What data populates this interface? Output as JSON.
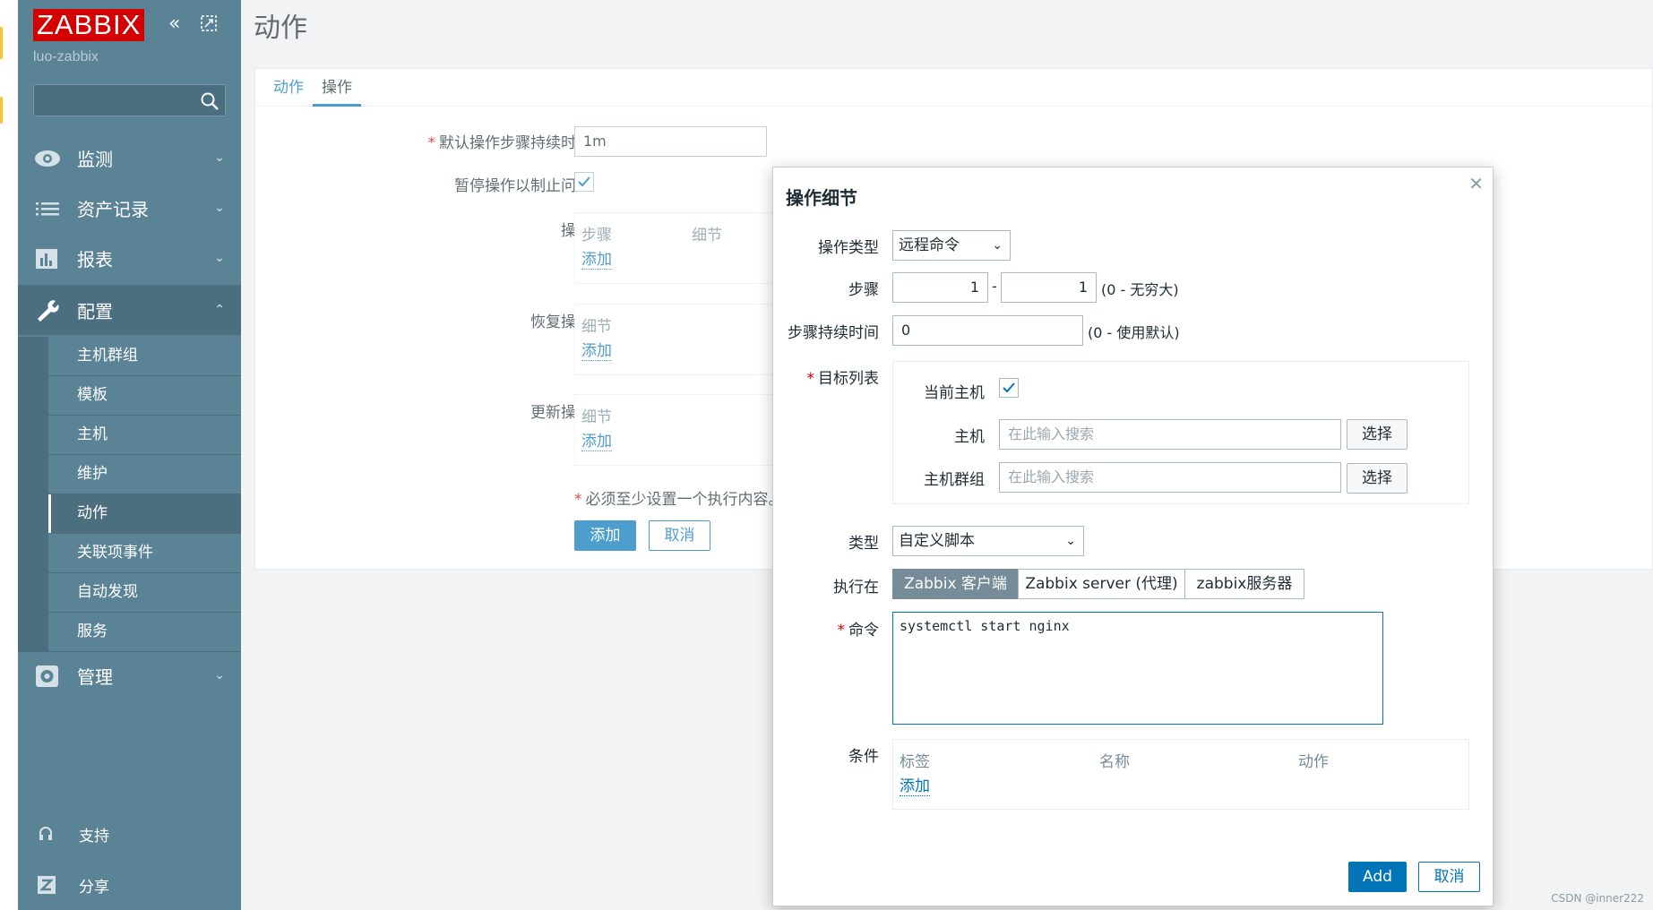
{
  "sidebar": {
    "logo": "ZABBIX",
    "server_name": "luo-zabbix",
    "collapse_icon": "double-chevron-left-icon",
    "kiosk_icon": "kiosk-mode-icon",
    "menu": [
      {
        "label": "监测",
        "icon": "eye-icon"
      },
      {
        "label": "资产记录",
        "icon": "list-icon"
      },
      {
        "label": "报表",
        "icon": "bar-chart-icon"
      },
      {
        "label": "配置",
        "icon": "wrench-icon"
      },
      {
        "label": "管理",
        "icon": "gear-icon"
      }
    ],
    "submenu": [
      "主机群组",
      "模板",
      "主机",
      "维护",
      "动作",
      "关联项事件",
      "自动发现",
      "服务"
    ],
    "active_submenu": "动作",
    "footer": [
      {
        "label": "支持",
        "icon": "headset-icon"
      },
      {
        "label": "分享",
        "icon": "share-z-icon"
      }
    ]
  },
  "page": {
    "title": "动作",
    "tabs": [
      "动作",
      "操作"
    ],
    "active_tab": "操作"
  },
  "form": {
    "default_step_duration_label": "默认操作步骤持续时间",
    "default_step_duration_value": "1m",
    "pause_label": "暂停操作以制止问题",
    "pause_checked": true,
    "operations_label": "操作",
    "operations_headers": [
      "步骤",
      "细节"
    ],
    "recovery_label": "恢复操作",
    "recovery_headers": [
      "细节"
    ],
    "update_label": "更新操作",
    "update_headers": [
      "细节"
    ],
    "add_link": "添加",
    "required_note": "必须至少设置一个执行内容。",
    "add_button": "添加",
    "cancel_button": "取消"
  },
  "dialog": {
    "title": "操作细节",
    "operation_type_label": "操作类型",
    "operation_type_value": "远程命令",
    "steps_label": "步骤",
    "steps_from": "1",
    "steps_to": "1",
    "steps_note": "(0 - 无穷大)",
    "step_duration_label": "步骤持续时间",
    "step_duration_value": "0",
    "step_duration_note": "(0 - 使用默认)",
    "target_list_label": "目标列表",
    "current_host_label": "当前主机",
    "current_host_checked": true,
    "host_label": "主机",
    "host_placeholder": "在此输入搜索",
    "hostgroup_label": "主机群组",
    "hostgroup_placeholder": "在此输入搜索",
    "select_button": "选择",
    "type_label": "类型",
    "type_value": "自定义脚本",
    "execute_on_label": "执行在",
    "execute_on_options": [
      "Zabbix 客户端",
      "Zabbix server (代理)",
      "zabbix服务器"
    ],
    "execute_on_selected": "Zabbix 客户端",
    "command_label": "命令",
    "command_value": "systemctl start nginx",
    "conditions_label": "条件",
    "conditions_headers": [
      "标签",
      "名称",
      "动作"
    ],
    "conditions_add": "添加",
    "add_button": "Add",
    "cancel_button": "取消"
  },
  "watermark": "CSDN @inner222"
}
